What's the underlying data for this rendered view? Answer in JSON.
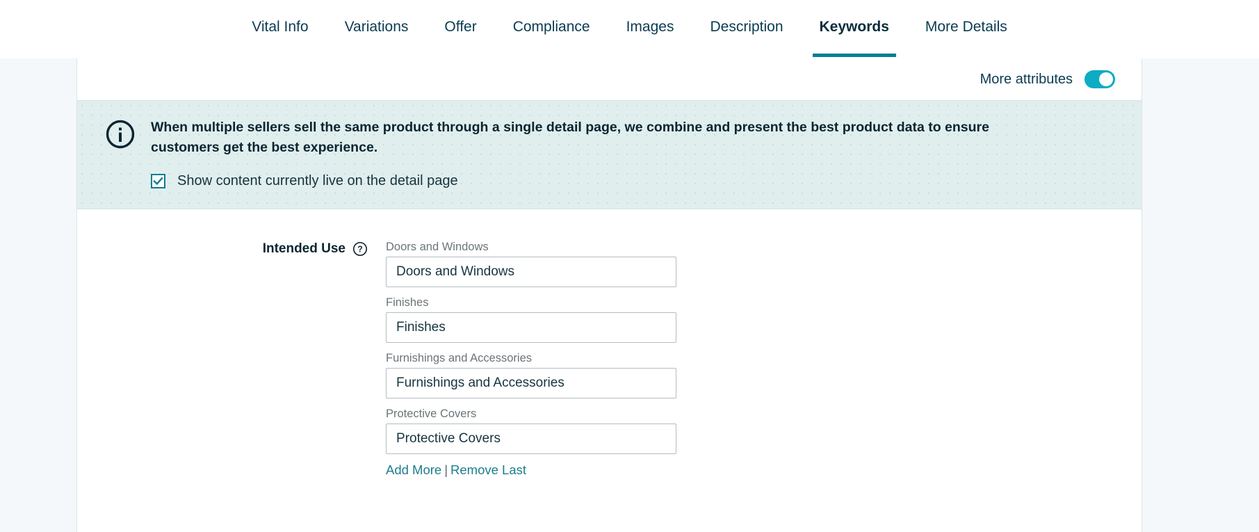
{
  "tabs": [
    {
      "label": "Vital Info",
      "active": false
    },
    {
      "label": "Variations",
      "active": false
    },
    {
      "label": "Offer",
      "active": false
    },
    {
      "label": "Compliance",
      "active": false
    },
    {
      "label": "Images",
      "active": false
    },
    {
      "label": "Description",
      "active": false
    },
    {
      "label": "Keywords",
      "active": true
    },
    {
      "label": "More Details",
      "active": false
    }
  ],
  "attributes_row": {
    "label": "More attributes",
    "toggle_on": true,
    "accent": "#0bacc4"
  },
  "banner": {
    "icon": "info-circle-icon",
    "message": "When multiple sellers sell the same product through a single detail page, we combine and present the best product data to ensure customers get the best experience.",
    "checkbox": {
      "label": "Show content currently live on the detail page",
      "checked": true,
      "accent": "#067d95"
    },
    "background": "#e1eeee"
  },
  "form": {
    "label": "Intended Use",
    "help_icon": "question-circle-icon",
    "fields": [
      {
        "sublabel": "Doors and Windows",
        "value": "Doors and Windows"
      },
      {
        "sublabel": "Finishes",
        "value": "Finishes"
      },
      {
        "sublabel": "Furnishings and Accessories",
        "value": "Furnishings and Accessories"
      },
      {
        "sublabel": "Protective Covers",
        "value": "Protective Covers"
      }
    ],
    "add_more": "Add More",
    "separator": "|",
    "remove_last": "Remove Last",
    "link_color": "#1d7d8c"
  }
}
